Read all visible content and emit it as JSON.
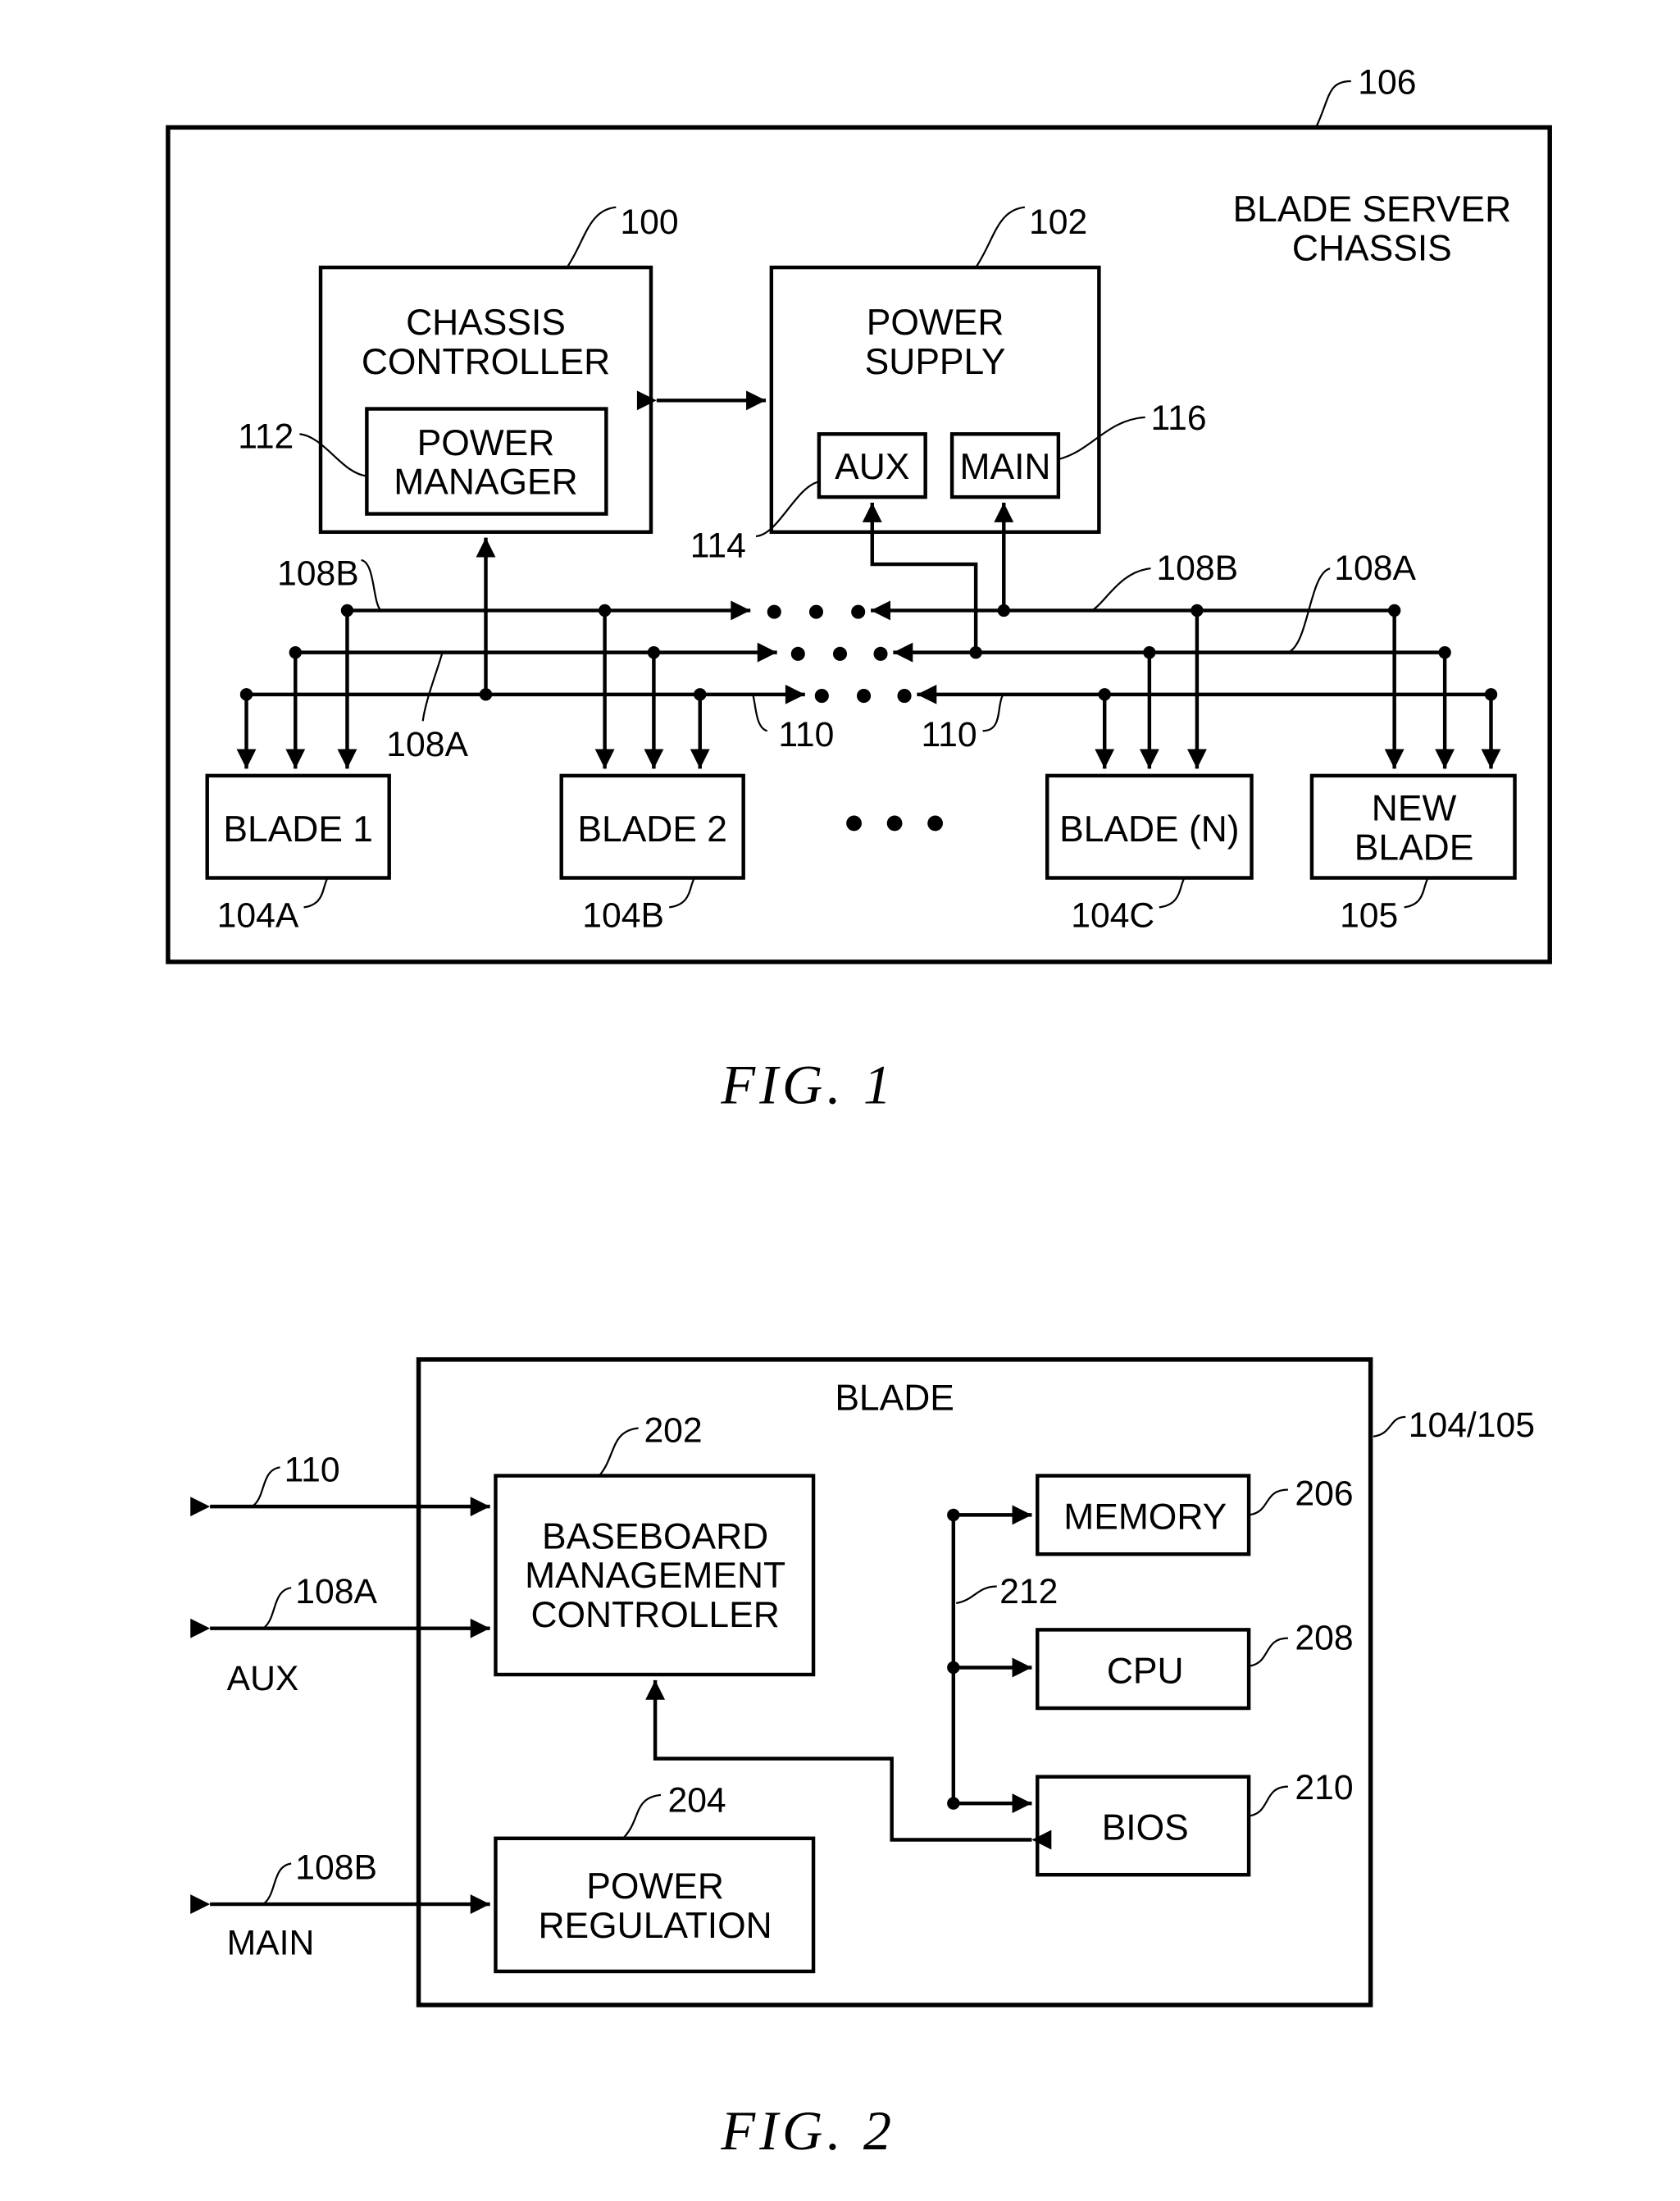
{
  "fig1": {
    "caption": "FIG.  1",
    "chassis": {
      "title_line1": "BLADE SERVER",
      "title_line2": "CHASSIS",
      "ref": "106"
    },
    "chassis_controller": {
      "line1": "CHASSIS",
      "line2": "CONTROLLER",
      "ref": "100"
    },
    "power_manager": {
      "line1": "POWER",
      "line2": "MANAGER",
      "ref": "112"
    },
    "power_supply": {
      "line1": "POWER",
      "line2": "SUPPLY",
      "ref": "102"
    },
    "aux": {
      "label": "AUX",
      "ref": "114"
    },
    "main": {
      "label": "MAIN",
      "ref": "116"
    },
    "buses": {
      "b108B_left": "108B",
      "b108A_left": "108A",
      "b110_left": "110",
      "b110_right": "110",
      "b108B_right": "108B",
      "b108A_right": "108A"
    },
    "blades": [
      {
        "label": "BLADE 1",
        "ref": "104A"
      },
      {
        "label": "BLADE 2",
        "ref": "104B"
      },
      {
        "label": "BLADE (N)",
        "ref": "104C"
      },
      {
        "line1": "NEW",
        "line2": "BLADE",
        "ref": "105"
      }
    ]
  },
  "fig2": {
    "caption": "FIG.  2",
    "blade": {
      "title": "BLADE",
      "ref": "104/105"
    },
    "bmc": {
      "line1": "BASEBOARD",
      "line2": "MANAGEMENT",
      "line3": "CONTROLLER",
      "ref": "202"
    },
    "power_regulation": {
      "line1": "POWER",
      "line2": "REGULATION",
      "ref": "204"
    },
    "memory": {
      "label": "MEMORY",
      "ref": "206"
    },
    "cpu": {
      "label": "CPU",
      "ref": "208"
    },
    "bios": {
      "label": "BIOS",
      "ref": "210"
    },
    "bus_ref": "212",
    "signals": {
      "s110": "110",
      "s108A": "108A",
      "aux_label": "AUX",
      "s108B": "108B",
      "main_label": "MAIN"
    }
  }
}
